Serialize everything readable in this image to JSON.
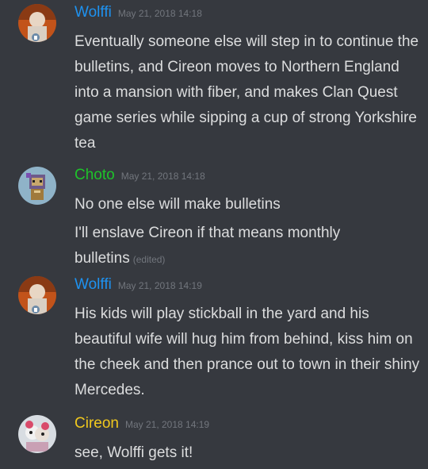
{
  "colors": {
    "background": "#36393f",
    "wolffi": "#1e92f0",
    "choto": "#1ec32a",
    "cireon": "#f0c81e",
    "timestamp": "#72767d",
    "text": "#dcddde"
  },
  "messages": [
    {
      "author": "Wolffi",
      "timestamp": "May 21, 2018 14:18",
      "lines": [
        "Eventually someone else will step in to continue the bulletins, and Cireon moves to Northern England into a mansion with fiber, and makes Clan Quest game series while sipping a cup of strong Yorkshire tea"
      ]
    },
    {
      "author": "Choto",
      "timestamp": "May 21, 2018 14:18",
      "lines": [
        "No one else will make bulletins",
        "I'll enslave Cireon if that means monthly bulletins"
      ],
      "edited_label": "(edited)"
    },
    {
      "author": "Wolffi",
      "timestamp": "May 21, 2018 14:19",
      "lines": [
        "His kids will play stickball in the yard and his beautiful wife will hug him from behind, kiss him on the cheek and then prance out to town in their shiny Mercedes."
      ]
    },
    {
      "author": "Cireon",
      "timestamp": "May 21, 2018 14:19",
      "lines": [
        "see, Wolffi gets it!"
      ]
    }
  ]
}
